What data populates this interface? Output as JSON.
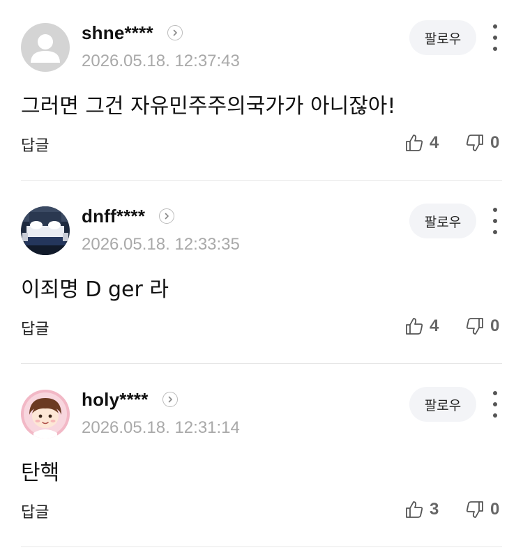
{
  "comments": [
    {
      "username": "shne****",
      "timestamp": "2026.05.18. 12:37:43",
      "follow_label": "팔로우",
      "text": "그러면 그건 자유민주주의국가가 아니잖아!",
      "reply_label": "답글",
      "likes": "4",
      "dislikes": "0",
      "avatar": "default-person-avatar"
    },
    {
      "username": "dnff****",
      "timestamp": "2026.05.18. 12:33:35",
      "follow_label": "팔로우",
      "text": "이죄명 D ger 라",
      "reply_label": "답글",
      "likes": "4",
      "dislikes": "0",
      "avatar": "bedroom-photo-avatar"
    },
    {
      "username": "holy****",
      "timestamp": "2026.05.18. 12:31:14",
      "follow_label": "팔로우",
      "text": "탄핵",
      "reply_label": "답글",
      "likes": "3",
      "dislikes": "0",
      "avatar": "cartoon-character-avatar"
    }
  ],
  "colors": {
    "timestamp": "#a9a9a9",
    "follow_bg": "#f3f4f7",
    "counts": "#666666",
    "divider": "#e6e6e6"
  }
}
